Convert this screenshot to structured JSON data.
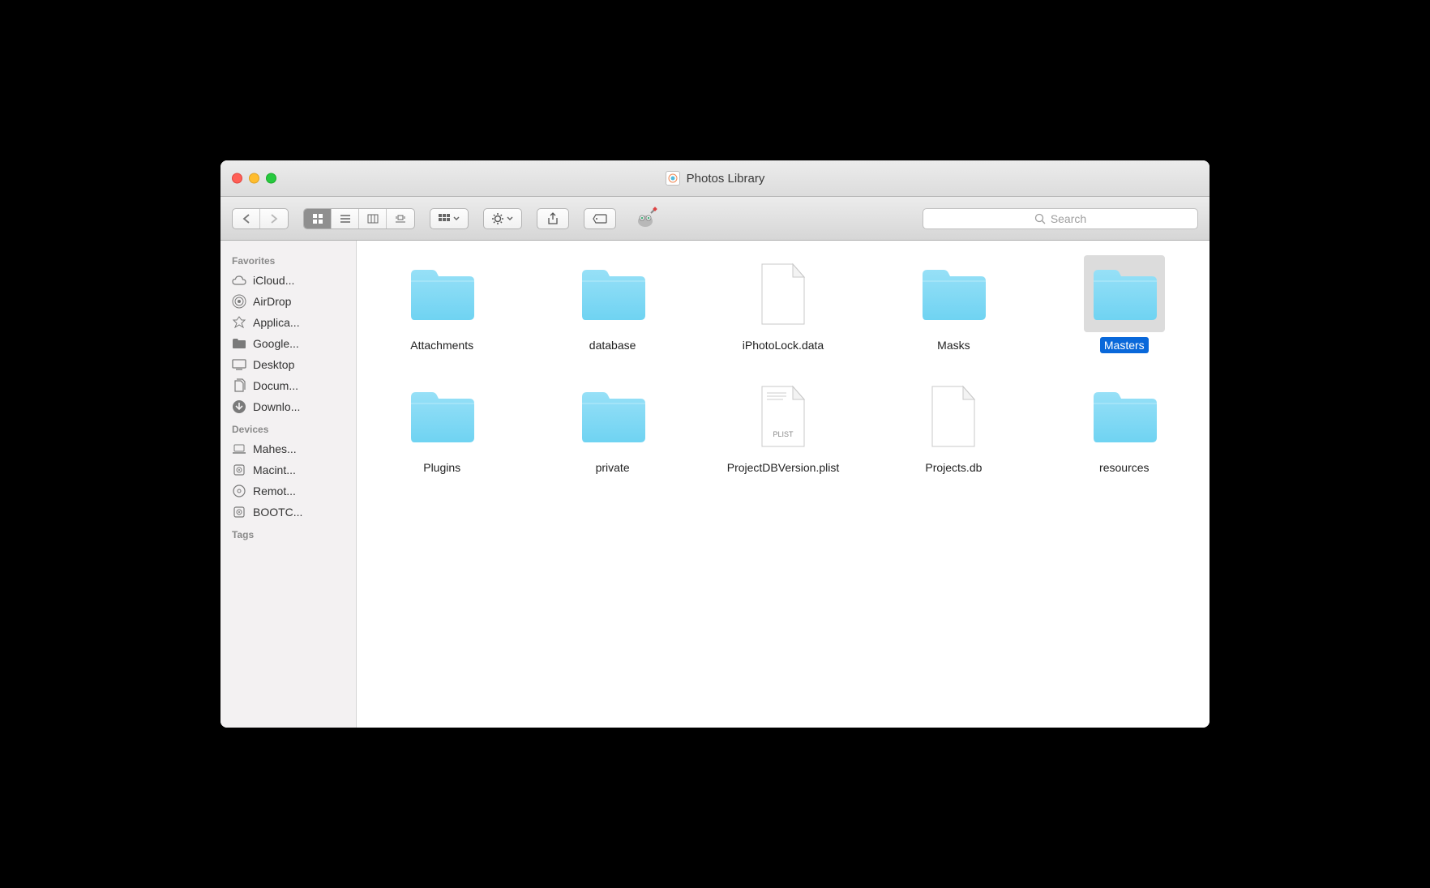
{
  "window": {
    "title": "Photos Library"
  },
  "search": {
    "placeholder": "Search"
  },
  "sidebar": {
    "sections": [
      {
        "header": "Favorites",
        "items": [
          {
            "label": "iCloud...",
            "icon": "cloud"
          },
          {
            "label": "AirDrop",
            "icon": "airdrop"
          },
          {
            "label": "Applica...",
            "icon": "apps"
          },
          {
            "label": "Google...",
            "icon": "folder"
          },
          {
            "label": "Desktop",
            "icon": "desktop"
          },
          {
            "label": "Docum...",
            "icon": "documents"
          },
          {
            "label": "Downlo...",
            "icon": "download"
          }
        ]
      },
      {
        "header": "Devices",
        "items": [
          {
            "label": "Mahes...",
            "icon": "laptop"
          },
          {
            "label": "Macint...",
            "icon": "hdd"
          },
          {
            "label": "Remot...",
            "icon": "optical"
          },
          {
            "label": "BOOTC...",
            "icon": "hdd"
          }
        ]
      },
      {
        "header": "Tags",
        "items": []
      }
    ]
  },
  "files": [
    {
      "name": "Attachments",
      "type": "folder",
      "selected": false
    },
    {
      "name": "database",
      "type": "folder",
      "selected": false
    },
    {
      "name": "iPhotoLock.data",
      "type": "file",
      "selected": false
    },
    {
      "name": "Masks",
      "type": "folder",
      "selected": false
    },
    {
      "name": "Masters",
      "type": "folder",
      "selected": true
    },
    {
      "name": "Plugins",
      "type": "folder",
      "selected": false
    },
    {
      "name": "private",
      "type": "folder",
      "selected": false
    },
    {
      "name": "ProjectDBVersion.plist",
      "type": "plist",
      "selected": false
    },
    {
      "name": "Projects.db",
      "type": "file",
      "selected": false
    },
    {
      "name": "resources",
      "type": "folder",
      "selected": false
    }
  ]
}
